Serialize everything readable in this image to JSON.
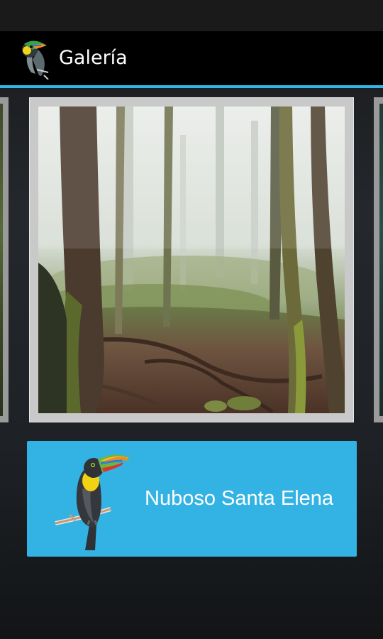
{
  "header": {
    "title": "Galería",
    "app_icon": "toucan-icon"
  },
  "gallery": {
    "selected_image": "cloud-forest-photo",
    "side_previews": [
      "gallery-prev-thumbnail",
      "gallery-next-thumbnail"
    ]
  },
  "banner": {
    "label": "Nuboso Santa Elena",
    "icon": "toucan-illustration"
  },
  "colors": {
    "accent": "#33b5e5",
    "banner": "#33b3e3",
    "actionbar": "#000000"
  }
}
